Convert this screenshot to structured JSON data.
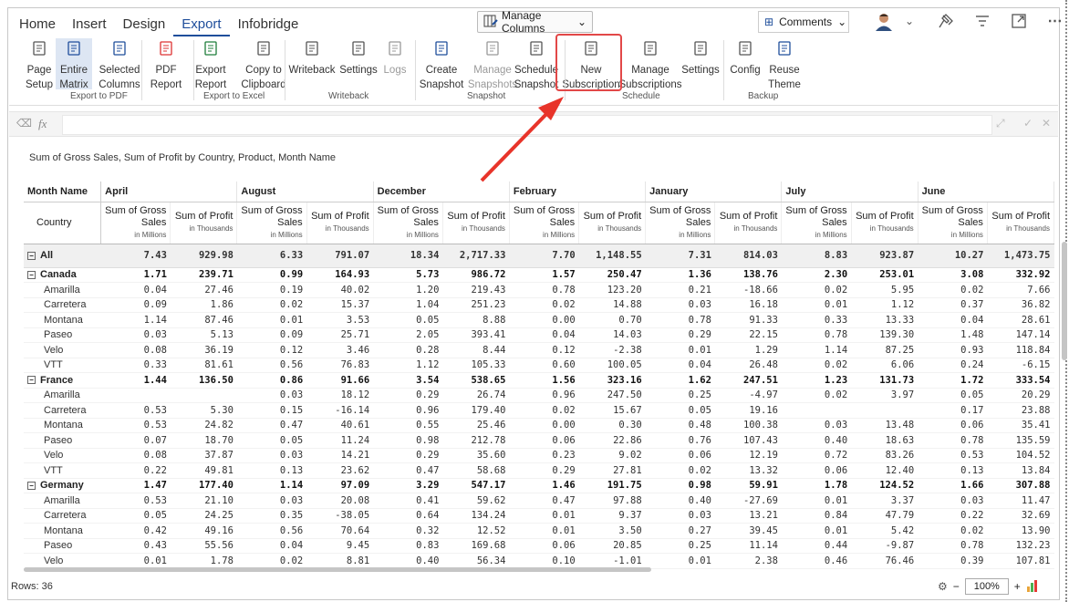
{
  "tabs": [
    "Home",
    "Insert",
    "Design",
    "Export",
    "Infobridge"
  ],
  "active_tab": "Export",
  "manage_columns": "Manage Columns",
  "comments": "Comments",
  "ribbon": {
    "buttons": [
      {
        "l1": "Page",
        "l2": "Setup"
      },
      {
        "l1": "Entire",
        "l2": "Matrix"
      },
      {
        "l1": "Selected",
        "l2": "Columns"
      },
      {
        "l1": "PDF",
        "l2": "Report"
      },
      {
        "l1": "Export",
        "l2": "Report"
      },
      {
        "l1": "Copy to",
        "l2": "Clipboard"
      },
      {
        "l1": "Writeback",
        "l2": ""
      },
      {
        "l1": "Settings",
        "l2": ""
      },
      {
        "l1": "Logs",
        "l2": ""
      },
      {
        "l1": "Create",
        "l2": "Snapshot"
      },
      {
        "l1": "Manage",
        "l2": "Snapshots"
      },
      {
        "l1": "Schedule",
        "l2": "Snapshot"
      },
      {
        "l1": "New",
        "l2": "Subscription"
      },
      {
        "l1": "Manage",
        "l2": "Subscriptions"
      },
      {
        "l1": "Settings",
        "l2": ""
      },
      {
        "l1": "Config",
        "l2": ""
      },
      {
        "l1": "Reuse",
        "l2": "Theme"
      }
    ],
    "groups": [
      "Export to PDF",
      "Export to Excel",
      "Writeback",
      "Snapshot",
      "Schedule",
      "Backup"
    ]
  },
  "formula": {
    "fx": "fx"
  },
  "caption": "Sum of Gross Sales, Sum of Profit by Country, Product, Month Name",
  "grid": {
    "corner_top": "Month Name",
    "corner_bottom": "Country",
    "months": [
      "April",
      "August",
      "December",
      "February",
      "January",
      "July",
      "June"
    ],
    "sub_gross_l1": "Sum of Gross",
    "sub_gross_l2": "Sales",
    "sub_gross_unit": "in Millions",
    "sub_profit": "Sum of Profit",
    "sub_profit_unit": "in Thousands",
    "rows": [
      {
        "label": "All",
        "type": "all",
        "values": [
          "7.43",
          "929.98",
          "6.33",
          "791.07",
          "18.34",
          "2,717.33",
          "7.70",
          "1,148.55",
          "7.31",
          "814.03",
          "8.83",
          "923.87",
          "10.27",
          "1,473.75"
        ]
      },
      {
        "label": "Canada",
        "type": "country",
        "values": [
          "1.71",
          "239.71",
          "0.99",
          "164.93",
          "5.73",
          "986.72",
          "1.57",
          "250.47",
          "1.36",
          "138.76",
          "2.30",
          "253.01",
          "3.08",
          "332.92"
        ]
      },
      {
        "label": "Amarilla",
        "type": "child",
        "values": [
          "0.04",
          "27.46",
          "0.19",
          "40.02",
          "1.20",
          "219.43",
          "0.78",
          "123.20",
          "0.21",
          "-18.66",
          "0.02",
          "5.95",
          "0.02",
          "7.66"
        ]
      },
      {
        "label": "Carretera",
        "type": "child",
        "values": [
          "0.09",
          "1.86",
          "0.02",
          "15.37",
          "1.04",
          "251.23",
          "0.02",
          "14.88",
          "0.03",
          "16.18",
          "0.01",
          "1.12",
          "0.37",
          "36.82"
        ]
      },
      {
        "label": "Montana",
        "type": "child",
        "values": [
          "1.14",
          "87.46",
          "0.01",
          "3.53",
          "0.05",
          "8.88",
          "0.00",
          "0.70",
          "0.78",
          "91.33",
          "0.33",
          "13.33",
          "0.04",
          "28.61"
        ]
      },
      {
        "label": "Paseo",
        "type": "child",
        "values": [
          "0.03",
          "5.13",
          "0.09",
          "25.71",
          "2.05",
          "393.41",
          "0.04",
          "14.03",
          "0.29",
          "22.15",
          "0.78",
          "139.30",
          "1.48",
          "147.14"
        ]
      },
      {
        "label": "Velo",
        "type": "child",
        "values": [
          "0.08",
          "36.19",
          "0.12",
          "3.46",
          "0.28",
          "8.44",
          "0.12",
          "-2.38",
          "0.01",
          "1.29",
          "1.14",
          "87.25",
          "0.93",
          "118.84"
        ]
      },
      {
        "label": "VTT",
        "type": "child",
        "values": [
          "0.33",
          "81.61",
          "0.56",
          "76.83",
          "1.12",
          "105.33",
          "0.60",
          "100.05",
          "0.04",
          "26.48",
          "0.02",
          "6.06",
          "0.24",
          "-6.15"
        ]
      },
      {
        "label": "France",
        "type": "country",
        "values": [
          "1.44",
          "136.50",
          "0.86",
          "91.66",
          "3.54",
          "538.65",
          "1.56",
          "323.16",
          "1.62",
          "247.51",
          "1.23",
          "131.73",
          "1.72",
          "333.54"
        ]
      },
      {
        "label": "Amarilla",
        "type": "child",
        "values": [
          "",
          "",
          "0.03",
          "18.12",
          "0.29",
          "26.74",
          "0.96",
          "247.50",
          "0.25",
          "-4.97",
          "0.02",
          "3.97",
          "0.05",
          "20.29"
        ]
      },
      {
        "label": "Carretera",
        "type": "child",
        "values": [
          "0.53",
          "5.30",
          "0.15",
          "-16.14",
          "0.96",
          "179.40",
          "0.02",
          "15.67",
          "0.05",
          "19.16",
          "",
          "",
          "0.17",
          "23.88"
        ]
      },
      {
        "label": "Montana",
        "type": "child",
        "values": [
          "0.53",
          "24.82",
          "0.47",
          "40.61",
          "0.55",
          "25.46",
          "0.00",
          "0.30",
          "0.48",
          "100.38",
          "0.03",
          "13.48",
          "0.06",
          "35.41"
        ]
      },
      {
        "label": "Paseo",
        "type": "child",
        "values": [
          "0.07",
          "18.70",
          "0.05",
          "11.24",
          "0.98",
          "212.78",
          "0.06",
          "22.86",
          "0.76",
          "107.43",
          "0.40",
          "18.63",
          "0.78",
          "135.59"
        ]
      },
      {
        "label": "Velo",
        "type": "child",
        "values": [
          "0.08",
          "37.87",
          "0.03",
          "14.21",
          "0.29",
          "35.60",
          "0.23",
          "9.02",
          "0.06",
          "12.19",
          "0.72",
          "83.26",
          "0.53",
          "104.52"
        ]
      },
      {
        "label": "VTT",
        "type": "child",
        "values": [
          "0.22",
          "49.81",
          "0.13",
          "23.62",
          "0.47",
          "58.68",
          "0.29",
          "27.81",
          "0.02",
          "13.32",
          "0.06",
          "12.40",
          "0.13",
          "13.84"
        ]
      },
      {
        "label": "Germany",
        "type": "country",
        "values": [
          "1.47",
          "177.40",
          "1.14",
          "97.09",
          "3.29",
          "547.17",
          "1.46",
          "191.75",
          "0.98",
          "59.91",
          "1.78",
          "124.52",
          "1.66",
          "307.88"
        ]
      },
      {
        "label": "Amarilla",
        "type": "child",
        "values": [
          "0.53",
          "21.10",
          "0.03",
          "20.08",
          "0.41",
          "59.62",
          "0.47",
          "97.88",
          "0.40",
          "-27.69",
          "0.01",
          "3.37",
          "0.03",
          "11.47"
        ]
      },
      {
        "label": "Carretera",
        "type": "child",
        "values": [
          "0.05",
          "24.25",
          "0.35",
          "-38.05",
          "0.64",
          "134.24",
          "0.01",
          "9.37",
          "0.03",
          "13.21",
          "0.84",
          "47.79",
          "0.22",
          "32.69"
        ]
      },
      {
        "label": "Montana",
        "type": "child",
        "values": [
          "0.42",
          "49.16",
          "0.56",
          "70.64",
          "0.32",
          "12.52",
          "0.01",
          "3.50",
          "0.27",
          "39.45",
          "0.01",
          "5.42",
          "0.02",
          "13.90"
        ]
      },
      {
        "label": "Paseo",
        "type": "child",
        "values": [
          "0.43",
          "55.56",
          "0.04",
          "9.45",
          "0.83",
          "169.68",
          "0.06",
          "20.85",
          "0.25",
          "11.14",
          "0.44",
          "-9.87",
          "0.78",
          "132.23"
        ]
      },
      {
        "label": "Velo",
        "type": "child",
        "values": [
          "0.01",
          "1.78",
          "0.02",
          "8.81",
          "0.40",
          "56.34",
          "0.10",
          "-1.01",
          "0.01",
          "2.38",
          "0.46",
          "76.46",
          "0.39",
          "107.81"
        ]
      }
    ]
  },
  "status": {
    "rows": "Rows: 36",
    "zoom": "100%"
  },
  "colors": {
    "accent": "#1f4e9b",
    "highlight": "#e24848",
    "arrow": "#e8342a"
  }
}
